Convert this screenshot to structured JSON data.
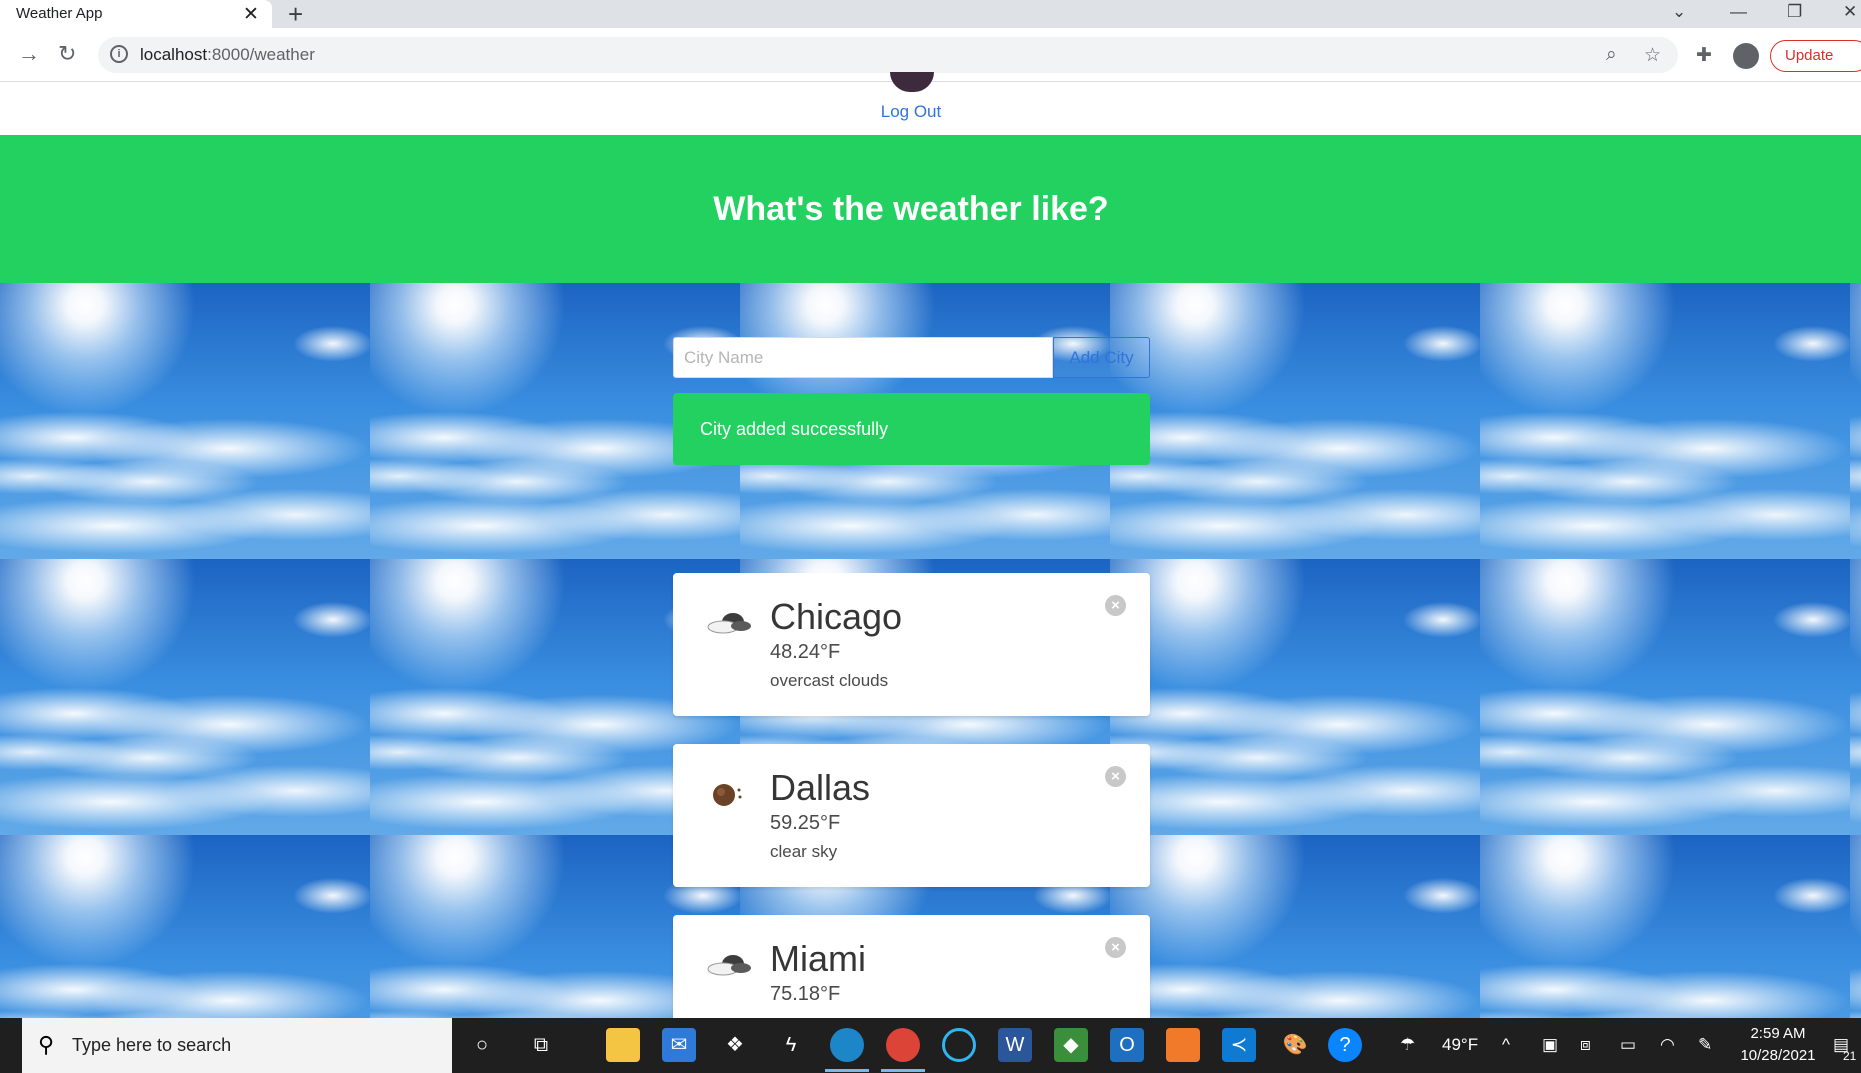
{
  "browser": {
    "tab_title": "Weather App",
    "url_host": "localhost",
    "url_path": ":8000/weather",
    "update_label": "Update"
  },
  "nav": {
    "logout_label": "Log Out"
  },
  "hero": {
    "title": "What's the weather like?"
  },
  "form": {
    "placeholder": "City Name",
    "add_label": "Add City"
  },
  "notice": {
    "message": "City added successfully"
  },
  "cities": [
    {
      "name": "Chicago",
      "temp": "48.24°F",
      "desc": "overcast clouds",
      "icon": "cloud-icon"
    },
    {
      "name": "Dallas",
      "temp": "59.25°F",
      "desc": "clear sky",
      "icon": "sun-icon"
    },
    {
      "name": "Miami",
      "temp": "75.18°F",
      "desc": "",
      "icon": "cloud-icon"
    }
  ],
  "taskbar": {
    "search_placeholder": "Type here to search",
    "weather_temp": "49°F",
    "time": "2:59 AM",
    "date": "10/28/2021",
    "notification_count": "21"
  },
  "colors": {
    "primary": "#23d160",
    "link": "#3273dc"
  }
}
